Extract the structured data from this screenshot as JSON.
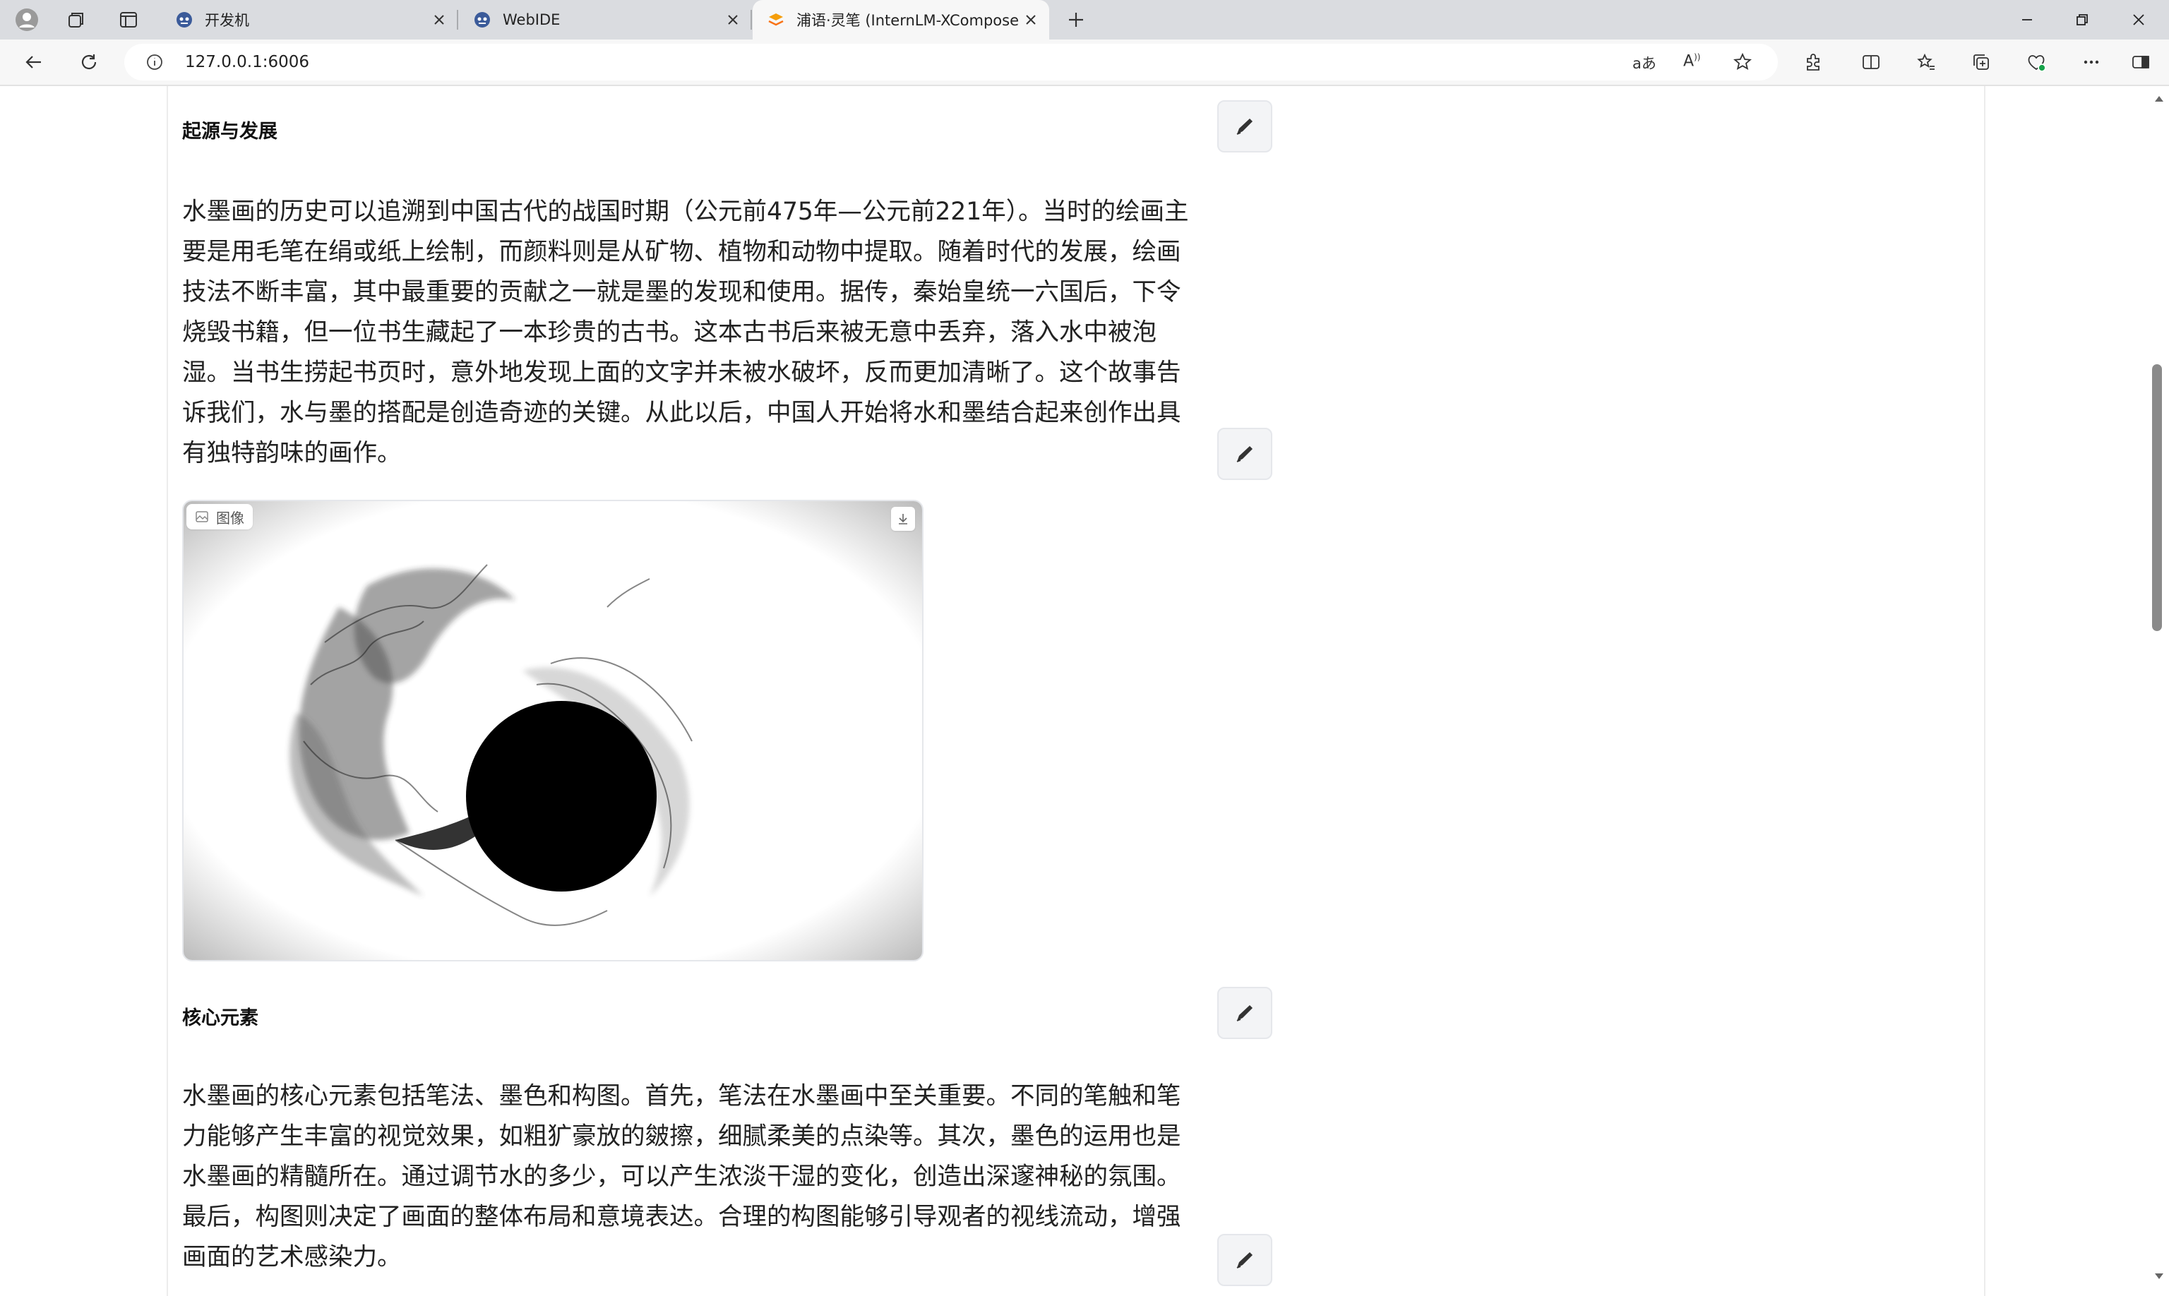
{
  "browser": {
    "tabs": [
      {
        "title": "开发机",
        "icon": "robot-icon",
        "active": false
      },
      {
        "title": "WebIDE",
        "icon": "robot-icon",
        "active": false
      },
      {
        "title": "浦语·灵笔 (InternLM-XComposer)",
        "icon": "gradio-logo-icon",
        "active": true
      }
    ],
    "new_tab_icon": "plus-icon",
    "address": {
      "url": "127.0.0.1:6006",
      "site_info_icon": "info-icon"
    },
    "toolbar_icons": [
      "translate-icon",
      "read-aloud-icon",
      "favorite-star-icon",
      "extensions-icon",
      "split-screen-icon",
      "favorites-icon",
      "collections-icon",
      "browser-essentials-icon",
      "more-icon",
      "sidebar-icon"
    ]
  },
  "article": {
    "section1": {
      "heading": "起源与发展",
      "paragraph_lines": [
        "水墨画的历史可以追溯到中国古代的战国时期（公元前475年—公元前221年）。当时的绘画主",
        "要是用毛笔在绢或纸上绘制，而颜料则是从矿物、植物和动物中提取。随着时代的发展，绘画",
        "技法不断丰富，其中最重要的贡献之一就是墨的发现和使用。据传，秦始皇统一六国后，下令",
        "烧毁书籍，但一位书生藏起了一本珍贵的古书。这本古书后来被无意中丢弃，落入水中被泡",
        "湿。当书生捞起书页时，意外地发现上面的文字并未被水破坏，反而更加清晰了。这个故事告",
        "诉我们，水与墨的搭配是创造奇迹的关键。从此以后，中国人开始将水和墨结合起来创作出具",
        "有独特韵味的画作。"
      ]
    },
    "image": {
      "label": "图像",
      "label_icon": "image-icon",
      "download_icon": "download-icon"
    },
    "section2": {
      "heading": "核心元素",
      "paragraph_lines": [
        "水墨画的核心元素包括笔法、墨色和构图。首先，笔法在水墨画中至关重要。不同的笔触和笔",
        "力能够产生丰富的视觉效果，如粗犷豪放的皴擦，细腻柔美的点染等。其次，墨色的运用也是",
        "水墨画的精髓所在。通过调节水的多少，可以产生浓淡干湿的变化，创造出深邃神秘的氛围。",
        "最后，构图则决定了画面的整体布局和意境表达。合理的构图能够引导观者的视线流动，增强",
        "画面的艺术感染力。"
      ]
    },
    "edit_icon": "pen-edit-icon"
  },
  "scrollbar": {
    "position_fraction": 0.3
  }
}
